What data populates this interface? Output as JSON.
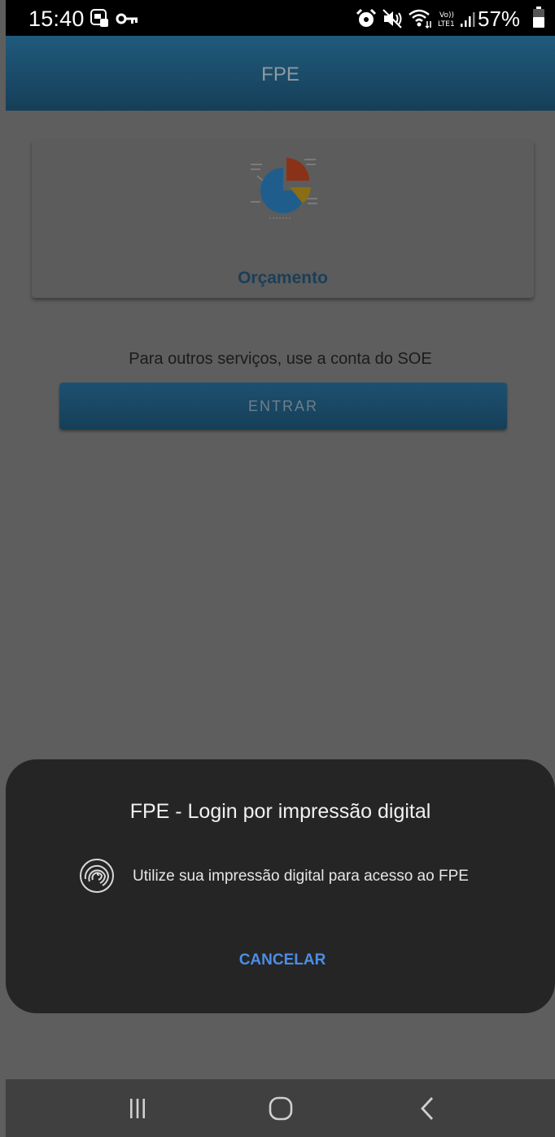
{
  "status_bar": {
    "time": "15:40",
    "battery_percent": "57%",
    "left_icons": [
      "screenshot-icon",
      "key-icon"
    ],
    "right_icons": [
      "alarm-icon",
      "mute-icon",
      "wifi-icon",
      "volte-lte1-icon",
      "signal-icon",
      "battery-icon"
    ]
  },
  "app_bar": {
    "title": "FPE",
    "color": "#1f5a7c"
  },
  "card": {
    "label": "Orçamento",
    "icon": "pie-chart-icon"
  },
  "info_text": "Para outros serviços, use a conta do SOE",
  "entrar_button": {
    "label": "ENTRAR"
  },
  "dialog": {
    "title": "FPE - Login por impressão digital",
    "message": "Utilize sua impressão digital para acesso ao FPE",
    "icon": "fingerprint-icon",
    "cancel_label": "CANCELAR",
    "accent": "#4d8de6"
  },
  "nav_bar": {
    "buttons": [
      "recent-apps-icon",
      "home-icon",
      "back-icon"
    ]
  }
}
